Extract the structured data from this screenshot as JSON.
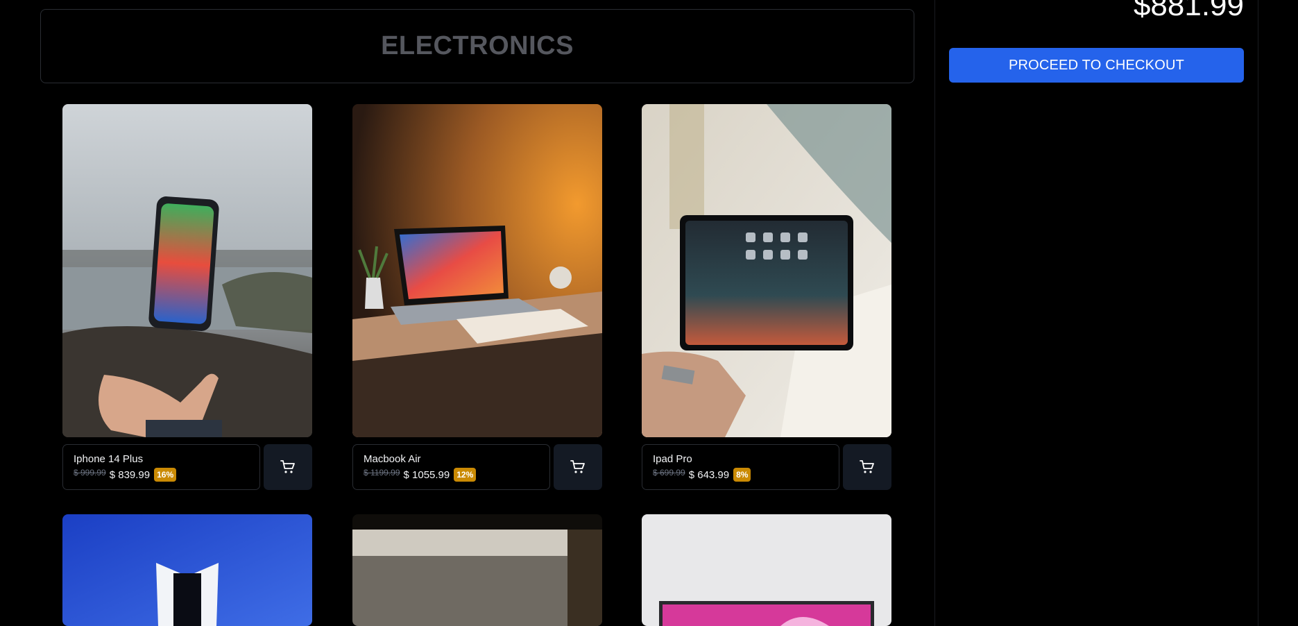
{
  "category": {
    "title": "ELECTRONICS"
  },
  "cart": {
    "total": "$881.99",
    "checkout_label": "PROCEED TO CHECKOUT"
  },
  "products": [
    {
      "name": "Iphone 14 Plus",
      "old_price": "$ 999.99",
      "price": "$ 839.99",
      "discount": "16%",
      "photo": "phone-floating-over-hand"
    },
    {
      "name": "Macbook Air",
      "old_price": "$ 1199.99",
      "price": "$ 1055.99",
      "discount": "12%",
      "photo": "laptop-on-desk-orange-light"
    },
    {
      "name": "Ipad Pro",
      "old_price": "$ 699.99",
      "price": "$ 643.99",
      "discount": "8%",
      "photo": "tablet-held-in-hand"
    },
    {
      "photo": "console-blue-background"
    },
    {
      "photo": "blurred-window-scene"
    },
    {
      "photo": "monitor-pink-screen"
    }
  ],
  "icons": {
    "cart": "cart-icon"
  },
  "colors": {
    "accent": "#2563eb",
    "badge": "#ca8a04",
    "background": "#000000"
  }
}
